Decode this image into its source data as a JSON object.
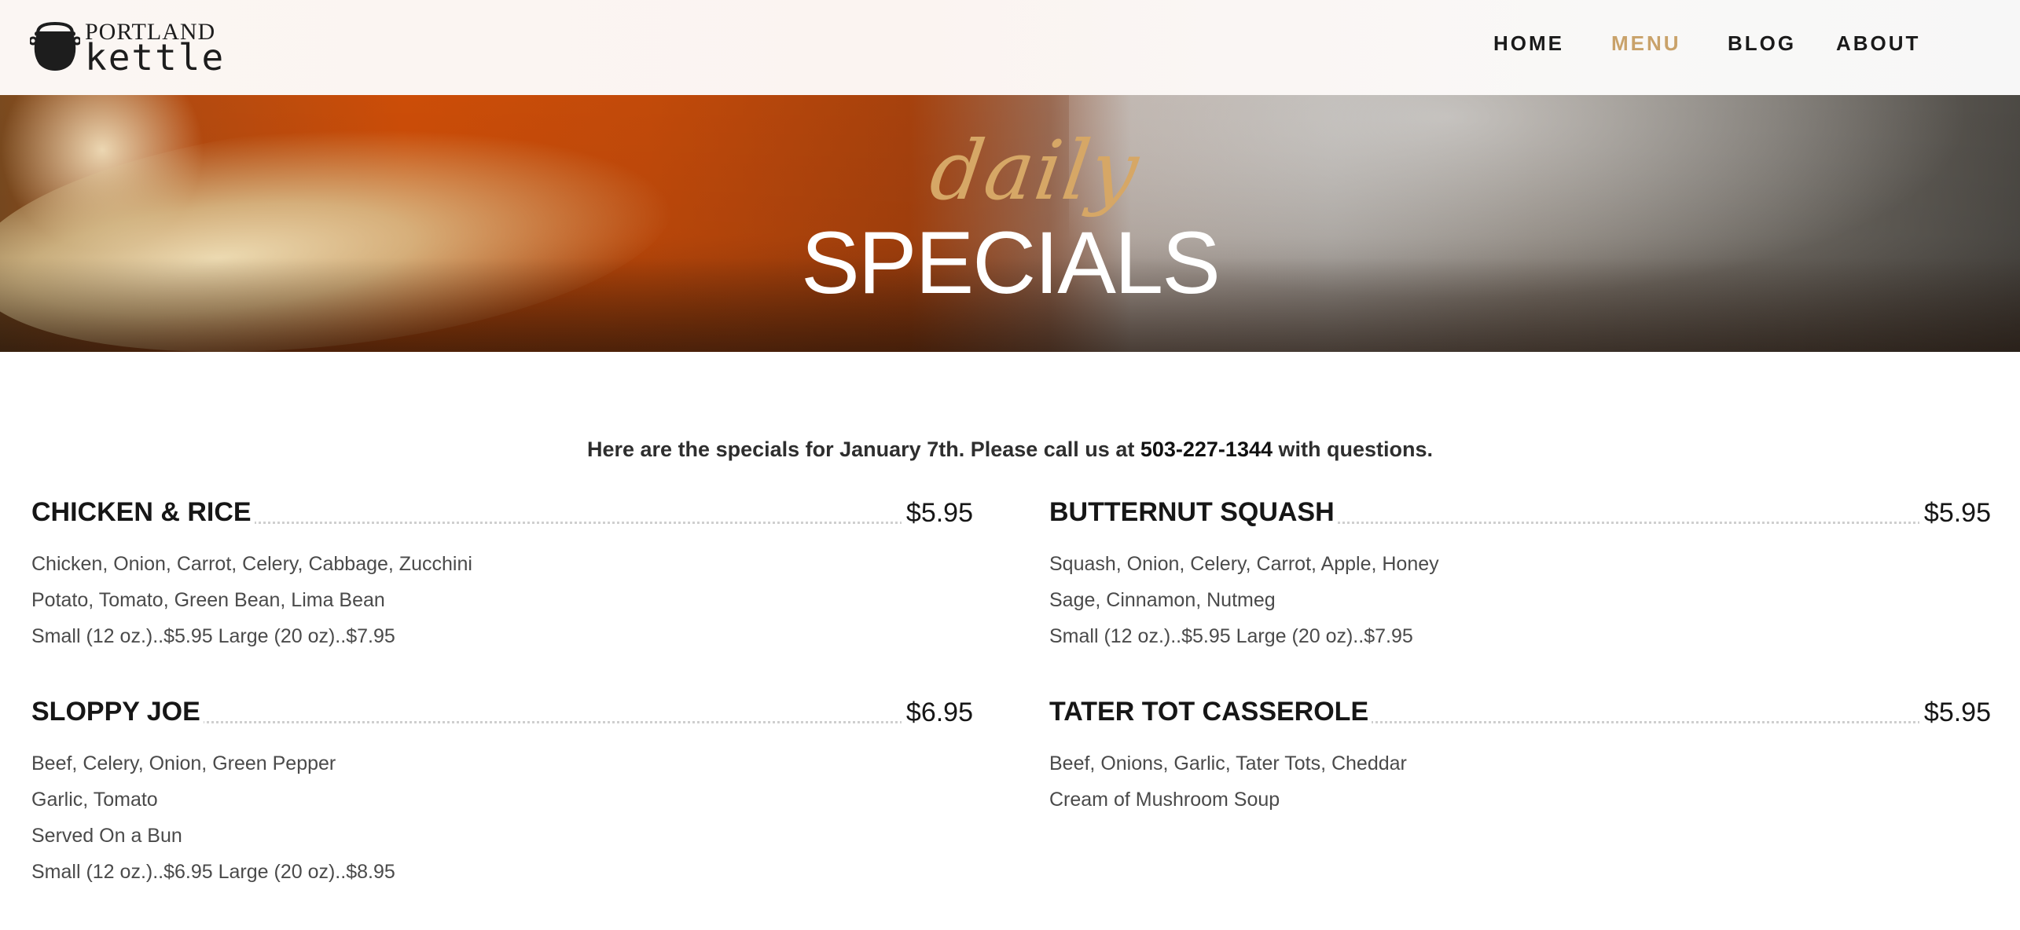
{
  "brand": {
    "line1": "PORTLAND",
    "line2": "kettle"
  },
  "nav": {
    "items": [
      {
        "label": "HOME",
        "active": false
      },
      {
        "label": "MENU",
        "active": true
      },
      {
        "label": "BLOG",
        "active": false
      },
      {
        "label": "ABOUT",
        "active": false
      }
    ],
    "active_color": "#c9a26a"
  },
  "hero": {
    "script_word": "daily",
    "title": "SPECIALS"
  },
  "intro": {
    "text_before": "Here are the specials for January 7th. Please call us at ",
    "phone": "503-227-1344",
    "text_after": " with questions."
  },
  "specials": [
    {
      "name": "CHICKEN & RICE",
      "price": "$5.95",
      "lines": [
        "Chicken, Onion, Carrot, Celery, Cabbage, Zucchini",
        "Potato, Tomato, Green Bean, Lima Bean",
        "Small (12 oz.)..$5.95 Large (20 oz)..$7.95"
      ]
    },
    {
      "name": "BUTTERNUT SQUASH",
      "price": "$5.95",
      "lines": [
        "Squash, Onion, Celery, Carrot, Apple, Honey",
        "Sage, Cinnamon, Nutmeg",
        "Small (12 oz.)..$5.95 Large (20 oz)..$7.95"
      ]
    },
    {
      "name": "SLOPPY JOE",
      "price": "$6.95",
      "lines": [
        "Beef, Celery, Onion, Green Pepper",
        "Garlic, Tomato",
        "Served On a Bun",
        "Small (12 oz.)..$6.95 Large (20 oz)..$8.95"
      ]
    },
    {
      "name": "TATER TOT CASSEROLE",
      "price": "$5.95",
      "lines": [
        "Beef, Onions, Garlic, Tater Tots, Cheddar",
        "Cream of Mushroom Soup"
      ]
    }
  ]
}
